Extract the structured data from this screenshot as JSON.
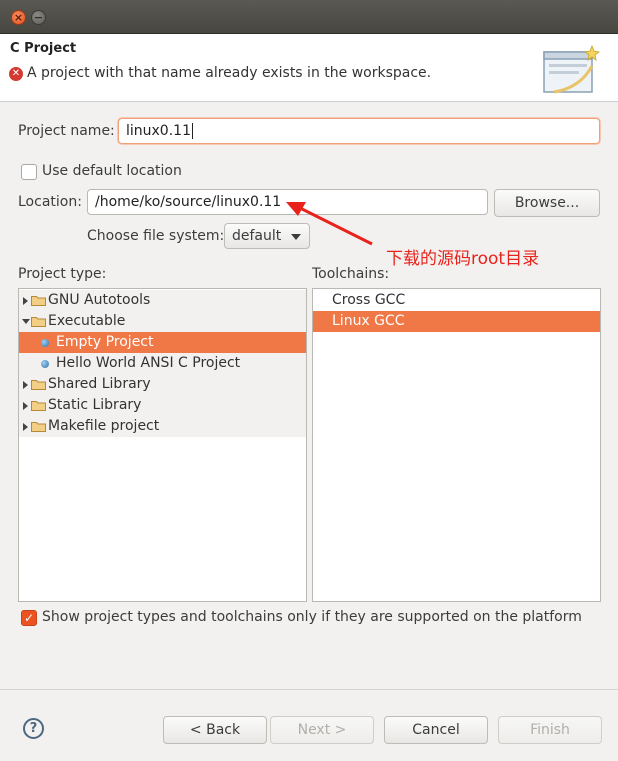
{
  "window": {
    "close_glyph": "×",
    "minimize_glyph": "−"
  },
  "header": {
    "title": "C Project",
    "error_glyph": "✕",
    "error_message": "A project with that name already exists in the workspace."
  },
  "project_name": {
    "label": "Project name:",
    "value": "linux0.11"
  },
  "use_default_location": {
    "label": "Use default location",
    "checked": false
  },
  "location": {
    "label": "Location:",
    "value": "/home/ko/source/linux0.11",
    "browse_label": "Browse..."
  },
  "file_system": {
    "label": "Choose file system:",
    "selected": "default"
  },
  "annotation": {
    "text": "下载的源码root目录",
    "color": "#e8231c"
  },
  "project_type": {
    "label": "Project type:",
    "items": [
      {
        "label": "GNU Autotools",
        "kind": "folder",
        "expanded": false
      },
      {
        "label": "Executable",
        "kind": "folder",
        "expanded": true
      },
      {
        "label": "Empty Project",
        "kind": "leaf",
        "selected": true
      },
      {
        "label": "Hello World ANSI C Project",
        "kind": "leaf"
      },
      {
        "label": "Shared Library",
        "kind": "folder",
        "expanded": false
      },
      {
        "label": "Static Library",
        "kind": "folder",
        "expanded": false
      },
      {
        "label": "Makefile project",
        "kind": "folder",
        "expanded": false
      }
    ]
  },
  "toolchains": {
    "label": "Toolchains:",
    "items": [
      {
        "label": "Cross GCC"
      },
      {
        "label": "Linux GCC",
        "selected": true
      }
    ]
  },
  "supported_only": {
    "label": "Show project types and toolchains only if they are supported on the platform",
    "checked": true,
    "check_glyph": "✓"
  },
  "footer": {
    "help_glyph": "?",
    "back_label": "< Back",
    "next_label": "Next >",
    "cancel_label": "Cancel",
    "finish_label": "Finish"
  },
  "colors": {
    "accent": "#e95420",
    "selection": "#f07746",
    "error": "#d33a32"
  }
}
